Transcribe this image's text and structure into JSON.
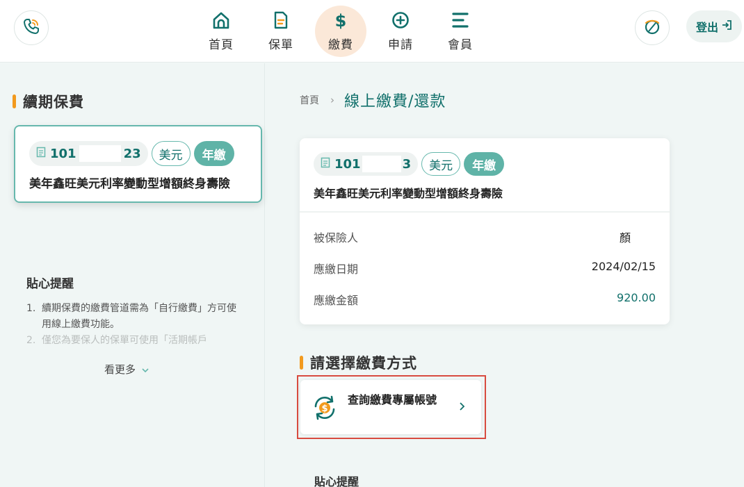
{
  "header": {
    "nav": [
      {
        "label": "首頁",
        "icon": "home-icon"
      },
      {
        "label": "保單",
        "icon": "document-icon"
      },
      {
        "label": "繳費",
        "icon": "dollar-icon",
        "active": true
      },
      {
        "label": "申請",
        "icon": "plus-circle-icon"
      },
      {
        "label": "會員",
        "icon": "menu-icon"
      }
    ],
    "logout_label": "登出"
  },
  "left": {
    "title": "續期保費",
    "policy": {
      "number_start": "101",
      "number_end": "23",
      "currency": "美元",
      "frequency": "年繳",
      "product": "美年鑫旺美元利率變動型增額終身壽險"
    },
    "reminder": {
      "title": "貼心提醒",
      "items": [
        {
          "num": "1.",
          "text": "續期保費的繳費管道需為「自行繳費」方可使用線上繳費功能。"
        },
        {
          "num": "2.",
          "text": "僅您為要保人的保單可使用「活期帳戶"
        }
      ],
      "see_more": "看更多"
    }
  },
  "breadcrumb": {
    "home": "首頁",
    "current": "線上繳費/還款"
  },
  "detail": {
    "number_start": "101",
    "number_end": "3",
    "currency": "美元",
    "frequency": "年繳",
    "product": "美年鑫旺美元利率變動型增額終身壽險",
    "rows": [
      {
        "label": "被保險人",
        "value": "顏"
      },
      {
        "label": "應繳日期",
        "value": "2024/02/15"
      },
      {
        "label": "應繳金額",
        "value": "920.00"
      }
    ]
  },
  "payment": {
    "title": "請選擇繳費方式",
    "option_label": "查詢繳費專屬帳號"
  },
  "reminder_right": "貼心提醒",
  "colors": {
    "accent": "#11706b",
    "orange": "#f29a1e",
    "highlight": "#d84b3f"
  }
}
